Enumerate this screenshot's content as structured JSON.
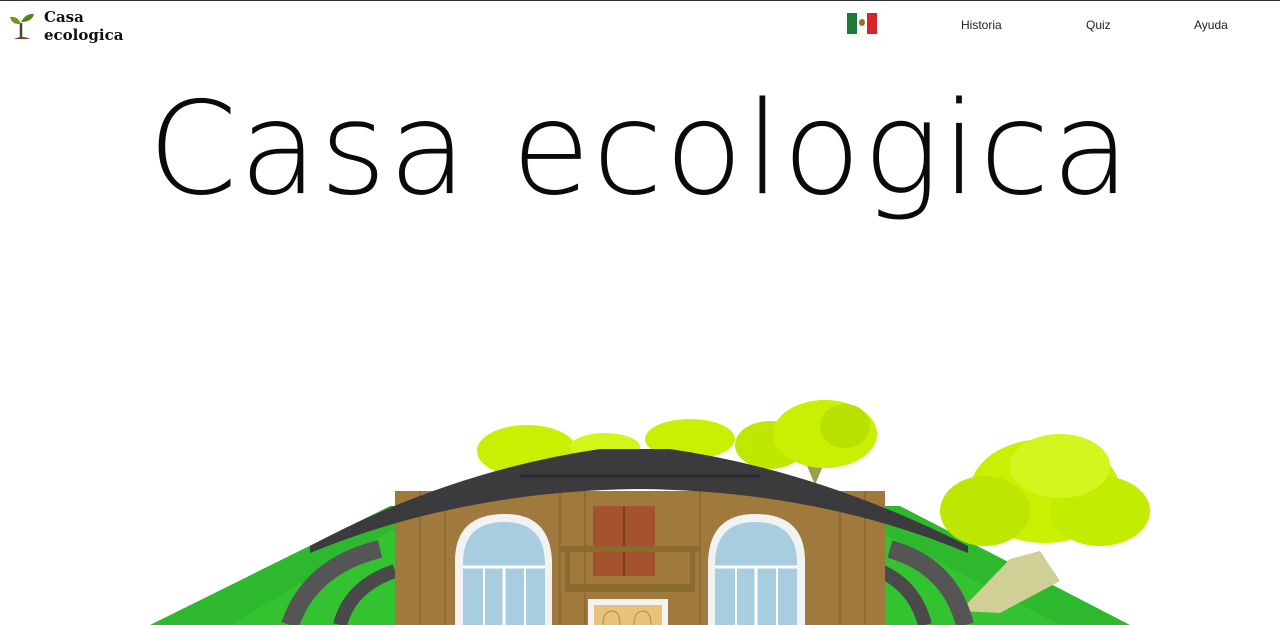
{
  "brand": {
    "line1": "Casa",
    "line2": "ecologica",
    "logo_icon": "sprout-icon"
  },
  "nav": {
    "flag_icon": "mexico-flag-icon",
    "links": [
      "Historia",
      "Quiz",
      "Ayuda"
    ]
  },
  "hero": {
    "title": "Casa ecologica"
  },
  "colors": {
    "grass": "#2db82d",
    "foliage": "#c8f000",
    "roof": "#3b3a3c",
    "wall": "#a07a3c",
    "window": "#a9cde0"
  }
}
